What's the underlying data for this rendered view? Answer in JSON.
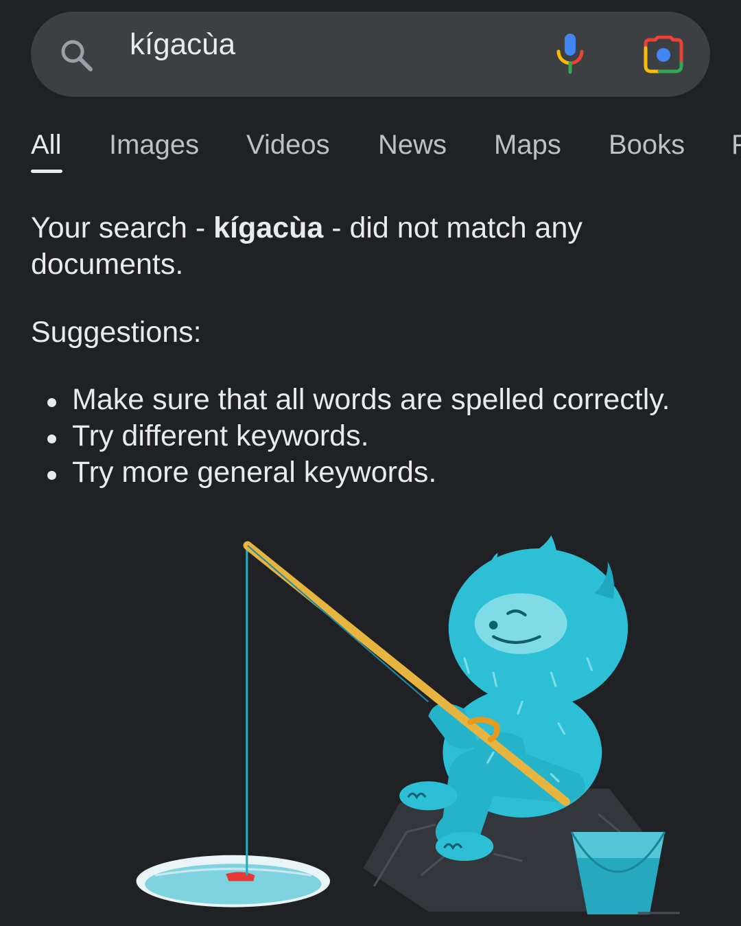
{
  "search": {
    "query": "kígacùa"
  },
  "tabs": [
    {
      "label": "All",
      "active": true
    },
    {
      "label": "Images",
      "active": false
    },
    {
      "label": "Videos",
      "active": false
    },
    {
      "label": "News",
      "active": false
    },
    {
      "label": "Maps",
      "active": false
    },
    {
      "label": "Books",
      "active": false
    },
    {
      "label": "F",
      "active": false
    }
  ],
  "message": {
    "prefix": "Your search - ",
    "query": "kígacùa",
    "suffix": " - did not match any documents."
  },
  "suggestions": {
    "title": "Suggestions:",
    "items": [
      "Make sure that all words are spelled correctly.",
      "Try different keywords.",
      "Try more general keywords."
    ]
  },
  "icons": {
    "search": "search-icon",
    "mic": "mic-icon",
    "lens": "lens-icon"
  },
  "colors": {
    "background": "#202124",
    "search_bar": "#3c4043",
    "text": "#e8eaed",
    "tab_inactive": "#bdc1c6",
    "google_blue": "#4285f4",
    "google_red": "#ea4335",
    "google_yellow": "#fbbc04",
    "google_green": "#34a853",
    "mascot": "#2cbfd6"
  }
}
